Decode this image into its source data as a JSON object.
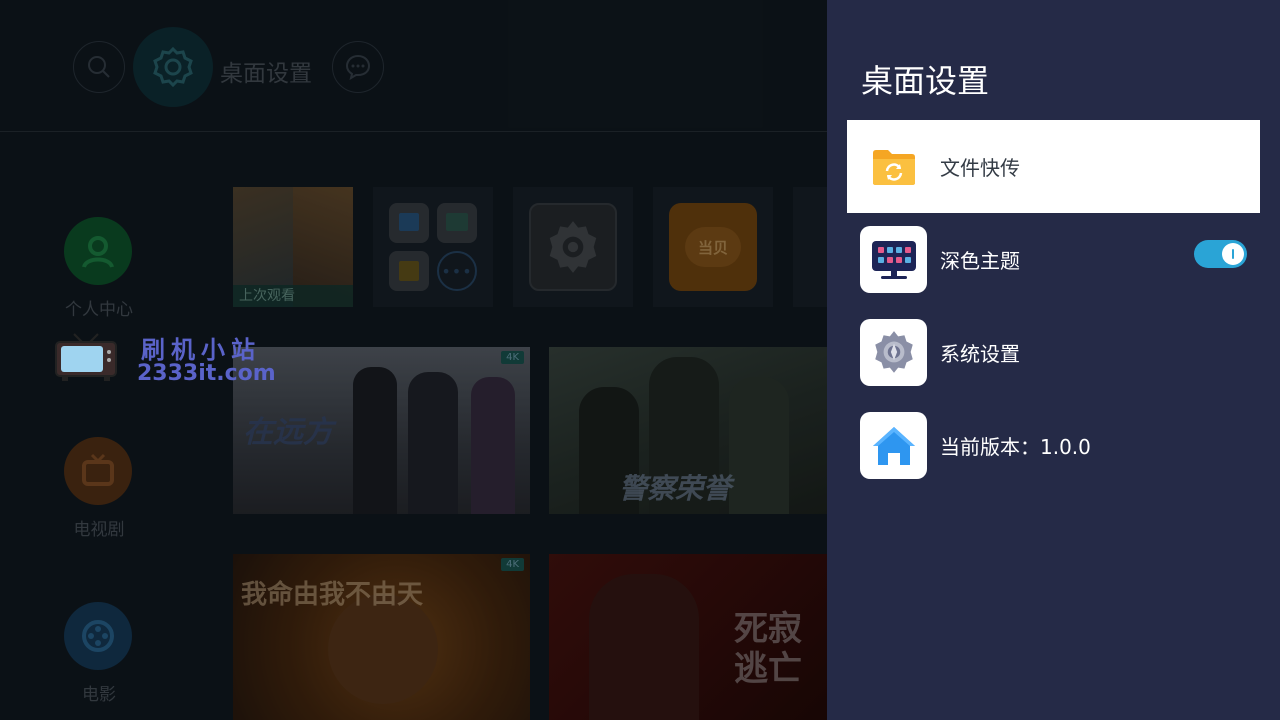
{
  "background": {
    "top_label": "桌面设置",
    "sidebar": [
      {
        "label": "个人中心"
      },
      {
        "label": "电视剧"
      },
      {
        "label": "电影"
      }
    ],
    "recent_label": "上次观看",
    "app_tile_label": "当贝",
    "badge_4k": "4K",
    "posters": [
      {
        "text": "在远方"
      },
      {
        "text": "警察荣誉"
      },
      {
        "text": "我命由我不由天"
      },
      {
        "text": "死寂逃亡"
      }
    ]
  },
  "watermark": {
    "title": "刷机小站",
    "url": "2333it.com"
  },
  "panel": {
    "title": "桌面设置",
    "items": [
      {
        "label": "文件快传",
        "icon": "folder-transfer-icon",
        "selected": true
      },
      {
        "label": "深色主题",
        "icon": "dark-theme-icon",
        "toggle": true
      },
      {
        "label": "系统设置",
        "icon": "gear-icon"
      },
      {
        "label": "当前版本：1.0.0",
        "icon": "home-icon"
      }
    ]
  },
  "colors": {
    "panel_bg": "#252a47",
    "toggle_on": "#2aa4d6",
    "watermark": "#5a63c9"
  }
}
